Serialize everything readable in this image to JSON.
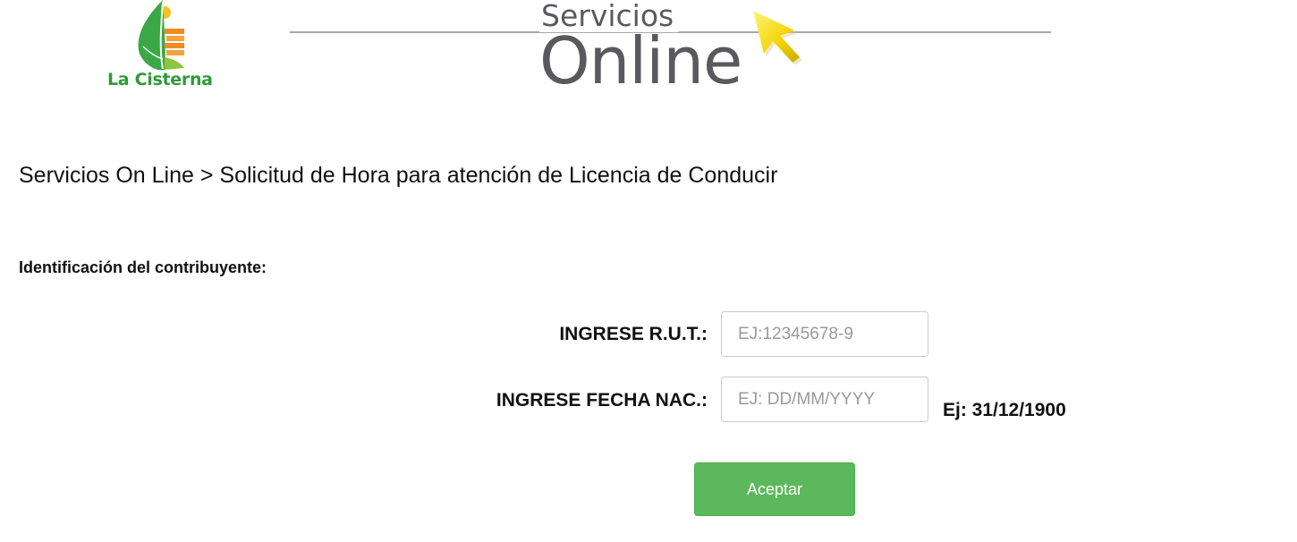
{
  "header": {
    "logo_text": "La Cisterna",
    "brand_small": "Servicios",
    "brand_large": "Online"
  },
  "breadcrumb": "Servicios On Line > Solicitud de Hora para atención de Licencia de Conducir",
  "section_title": "Identificación del contribuyente:",
  "form": {
    "rut": {
      "label": "INGRESE R.U.T.:",
      "value": "",
      "placeholder": "EJ:12345678-9"
    },
    "fecha": {
      "label": "INGRESE FECHA NAC.:",
      "value": "",
      "placeholder": "EJ: DD/MM/YYYY",
      "hint": "Ej: 31/12/1900"
    },
    "submit_label": "Aceptar"
  },
  "colors": {
    "logo_green": "#2f9a3a",
    "brand_gray": "#5a5a5e",
    "cursor_yellow": "#f5d300",
    "button_green": "#5cb85c"
  },
  "icons": {
    "logo": "leaf-logo-icon",
    "cursor": "pointer-arrow-icon"
  }
}
